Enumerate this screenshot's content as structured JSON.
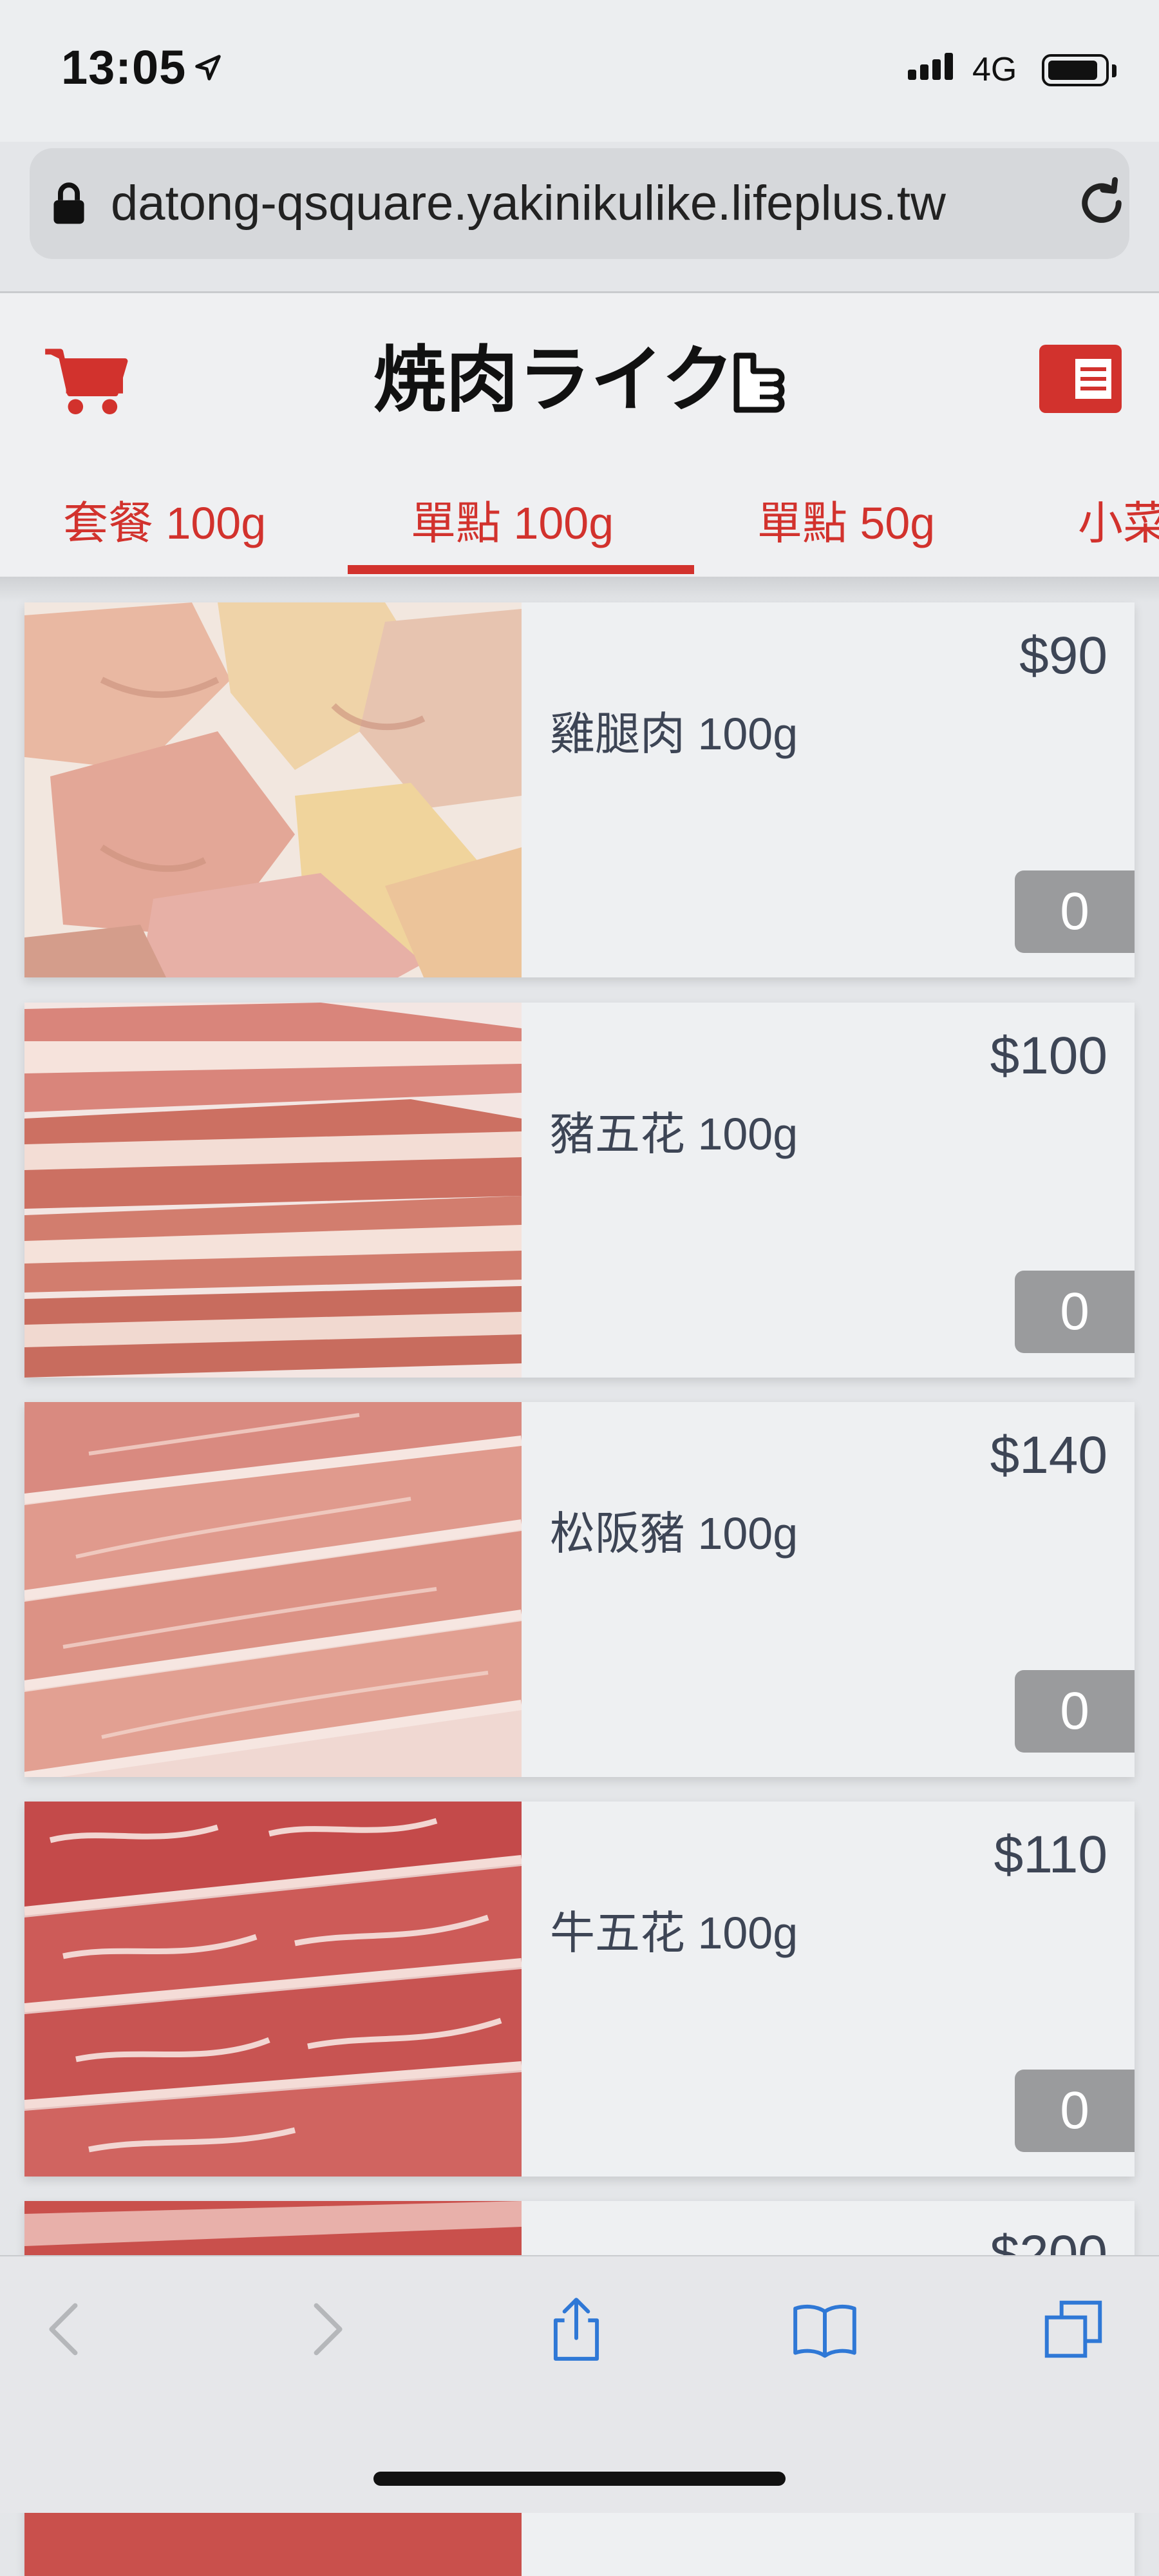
{
  "status_bar": {
    "time": "13:05",
    "network": "4G"
  },
  "browser": {
    "url": "datong-qsquare.yakinikulike.lifeplus.tw"
  },
  "app": {
    "logo_text": "焼肉ライク",
    "brand_color": "#d2322d",
    "tabs": [
      {
        "label": "套餐 100g",
        "active": false
      },
      {
        "label": "單點 100g",
        "active": true
      },
      {
        "label": "單點 50g",
        "active": false
      },
      {
        "label": "小菜",
        "active": false
      }
    ]
  },
  "menu_items": [
    {
      "name": "雞腿肉 100g",
      "price": "$90",
      "qty": "0",
      "image": "chicken-thigh-photo"
    },
    {
      "name": "豬五花 100g",
      "price": "$100",
      "qty": "0",
      "image": "pork-belly-photo"
    },
    {
      "name": "松阪豬 100g",
      "price": "$140",
      "qty": "0",
      "image": "pork-jowl-photo"
    },
    {
      "name": "牛五花 100g",
      "price": "$110",
      "qty": "0",
      "image": "beef-belly-photo"
    },
    {
      "name": "",
      "price": "$200",
      "qty": "",
      "image": "beef-photo"
    }
  ],
  "toolbar": {
    "icons": [
      "back-icon",
      "forward-icon",
      "share-icon",
      "bookmarks-icon",
      "tabs-icon"
    ]
  }
}
